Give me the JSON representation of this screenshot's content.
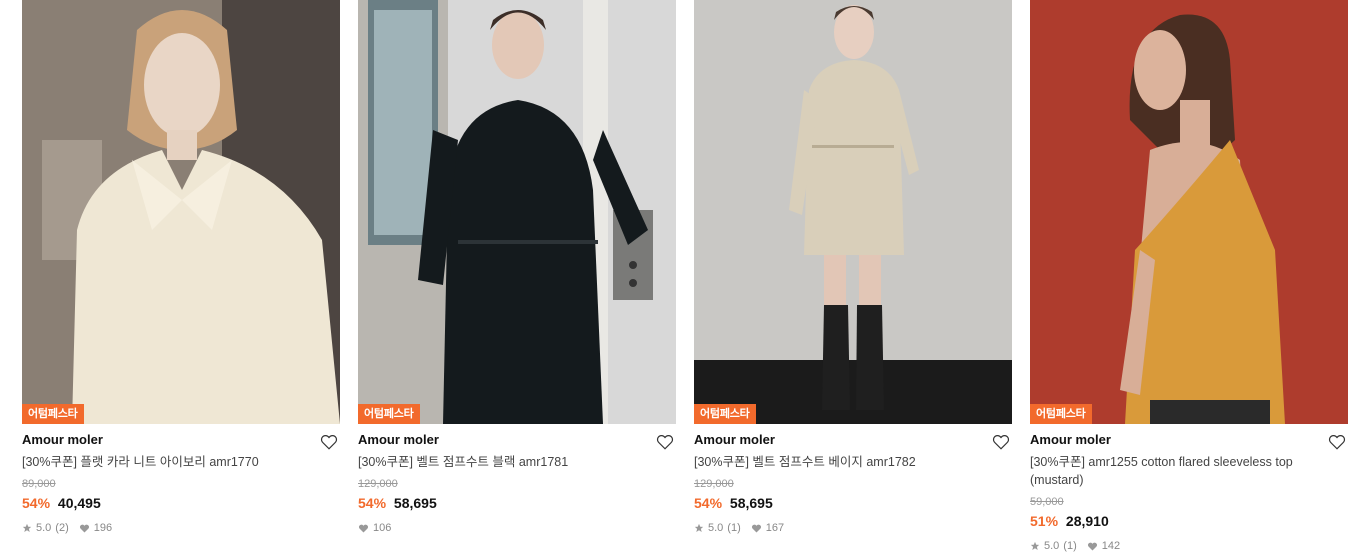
{
  "products": [
    {
      "badge": "어텀페스타",
      "brand": "Amour moler",
      "name": "[30%쿠폰] 플랫 카라 니트 아이보리 amr1770",
      "original_price": "89,000",
      "discount": "54%",
      "price": "40,495",
      "rating": "5.0",
      "reviews": "(2)",
      "likes": "196"
    },
    {
      "badge": "어텀페스타",
      "brand": "Amour moler",
      "name": "[30%쿠폰] 벨트 점프수트 블랙 amr1781",
      "original_price": "129,000",
      "discount": "54%",
      "price": "58,695",
      "likes": "106"
    },
    {
      "badge": "어텀페스타",
      "brand": "Amour moler",
      "name": "[30%쿠폰] 벨트 점프수트 베이지 amr1782",
      "original_price": "129,000",
      "discount": "54%",
      "price": "58,695",
      "rating": "5.0",
      "reviews": "(1)",
      "likes": "167"
    },
    {
      "badge": "어텀페스타",
      "brand": "Amour moler",
      "name": "[30%쿠폰] amr1255 cotton flared sleeveless top (mustard)",
      "original_price": "59,000",
      "discount": "51%",
      "price": "28,910",
      "rating": "5.0",
      "reviews": "(1)",
      "likes": "142"
    }
  ],
  "icons": {
    "wishlist": "heart-outline-icon",
    "rating": "star-icon",
    "likes": "heart-filled-icon"
  },
  "colors": {
    "accent": "#f26a2c",
    "muted": "#888888"
  }
}
